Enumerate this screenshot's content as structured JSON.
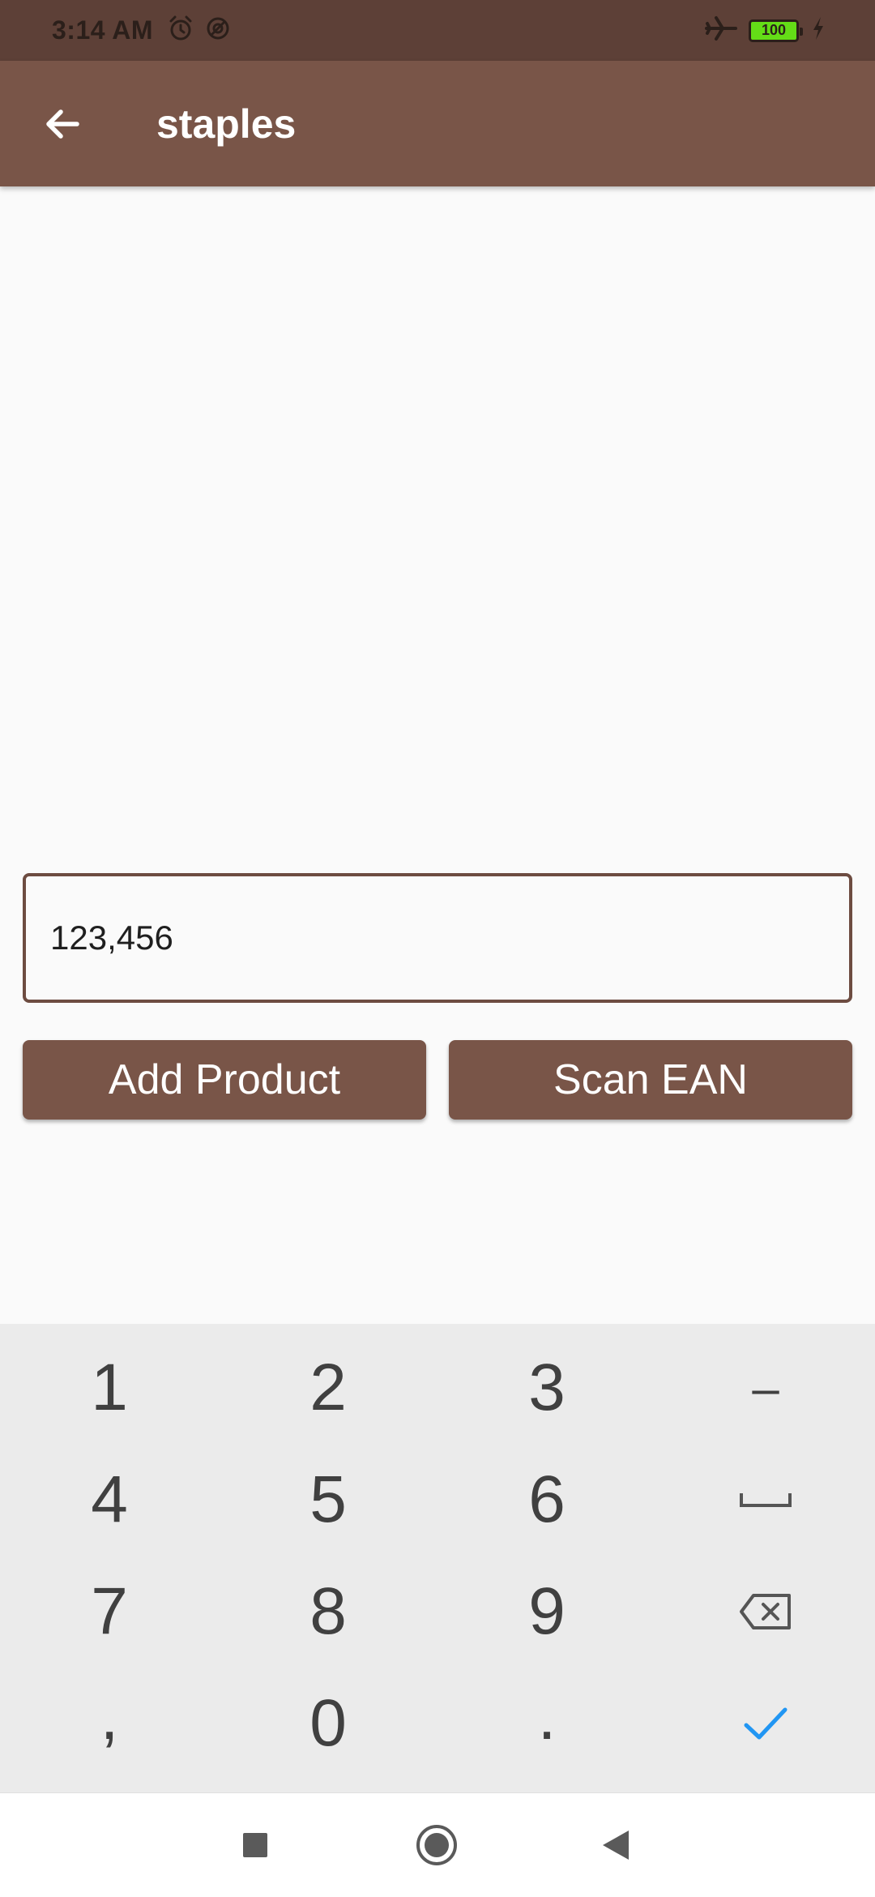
{
  "status_bar": {
    "time": "3:14 AM",
    "left_icons": [
      "alarm-icon",
      "data-saver-icon"
    ],
    "right_icons": [
      "airplane-mode-icon",
      "battery-icon",
      "charging-icon"
    ],
    "battery_level": "100"
  },
  "app_bar": {
    "title": "staples",
    "back_icon": "arrow-back-icon",
    "color": "#795548"
  },
  "input": {
    "value": "123,456"
  },
  "buttons": {
    "add_product": "Add Product",
    "scan_ean": "Scan EAN"
  },
  "keyboard": {
    "keys": [
      [
        "1",
        "2",
        "3",
        "–"
      ],
      [
        "4",
        "5",
        "6",
        "space"
      ],
      [
        "7",
        "8",
        "9",
        "backspace"
      ],
      [
        ",",
        "0",
        ".",
        "done"
      ]
    ],
    "accent": "#2196f3"
  },
  "nav_bar": {
    "buttons": [
      "recents-icon",
      "home-icon",
      "back-icon"
    ]
  }
}
